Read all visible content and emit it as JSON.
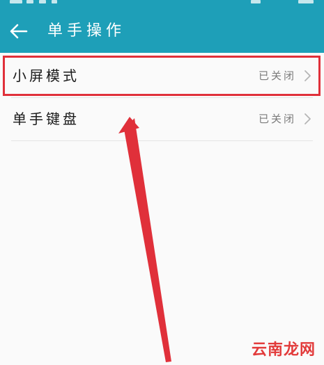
{
  "header": {
    "title": "单手操作"
  },
  "settings": {
    "items": [
      {
        "label": "小屏模式",
        "status": "已关闭"
      },
      {
        "label": "单手键盘",
        "status": "已关闭"
      }
    ]
  },
  "watermark": {
    "text": "云南龙网"
  },
  "colors": {
    "appbar": "#1e9fb8",
    "annotation": "#e0303a"
  },
  "icons": {
    "back": "arrow-left-icon",
    "chevron": "chevron-right-icon"
  }
}
